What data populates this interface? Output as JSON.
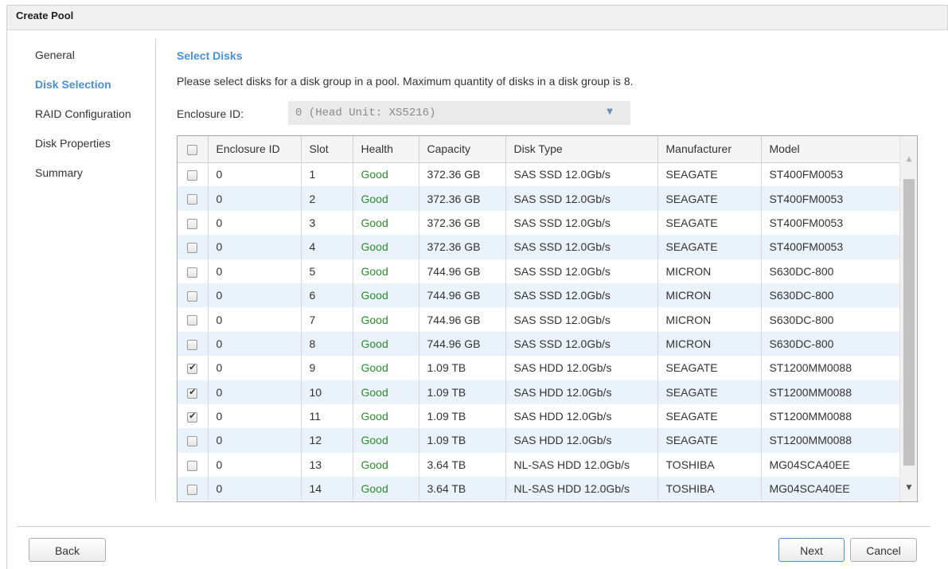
{
  "window": {
    "title": "Create Pool"
  },
  "nav": {
    "items": [
      {
        "label": "General",
        "active": false
      },
      {
        "label": "Disk Selection",
        "active": true
      },
      {
        "label": "RAID Configuration",
        "active": false
      },
      {
        "label": "Disk Properties",
        "active": false
      },
      {
        "label": "Summary",
        "active": false
      }
    ]
  },
  "main": {
    "section_title": "Select Disks",
    "instructions": "Please select disks for a disk group in a pool. Maximum quantity of disks in a disk group is 8.",
    "enclosure": {
      "label": "Enclosure ID:",
      "selected": "0 (Head Unit: XS5216)"
    }
  },
  "table": {
    "columns": [
      "Enclosure ID",
      "Slot",
      "Health",
      "Capacity",
      "Disk Type",
      "Manufacturer",
      "Model"
    ],
    "rows": [
      {
        "checked": false,
        "enclosure": "0",
        "slot": "1",
        "health": "Good",
        "capacity": "372.36 GB",
        "type": "SAS SSD 12.0Gb/s",
        "manufacturer": "SEAGATE",
        "model": "ST400FM0053"
      },
      {
        "checked": false,
        "enclosure": "0",
        "slot": "2",
        "health": "Good",
        "capacity": "372.36 GB",
        "type": "SAS SSD 12.0Gb/s",
        "manufacturer": "SEAGATE",
        "model": "ST400FM0053"
      },
      {
        "checked": false,
        "enclosure": "0",
        "slot": "3",
        "health": "Good",
        "capacity": "372.36 GB",
        "type": "SAS SSD 12.0Gb/s",
        "manufacturer": "SEAGATE",
        "model": "ST400FM0053"
      },
      {
        "checked": false,
        "enclosure": "0",
        "slot": "4",
        "health": "Good",
        "capacity": "372.36 GB",
        "type": "SAS SSD 12.0Gb/s",
        "manufacturer": "SEAGATE",
        "model": "ST400FM0053"
      },
      {
        "checked": false,
        "enclosure": "0",
        "slot": "5",
        "health": "Good",
        "capacity": "744.96 GB",
        "type": "SAS SSD 12.0Gb/s",
        "manufacturer": "MICRON",
        "model": "S630DC-800"
      },
      {
        "checked": false,
        "enclosure": "0",
        "slot": "6",
        "health": "Good",
        "capacity": "744.96 GB",
        "type": "SAS SSD 12.0Gb/s",
        "manufacturer": "MICRON",
        "model": "S630DC-800"
      },
      {
        "checked": false,
        "enclosure": "0",
        "slot": "7",
        "health": "Good",
        "capacity": "744.96 GB",
        "type": "SAS SSD 12.0Gb/s",
        "manufacturer": "MICRON",
        "model": "S630DC-800"
      },
      {
        "checked": false,
        "enclosure": "0",
        "slot": "8",
        "health": "Good",
        "capacity": "744.96 GB",
        "type": "SAS SSD 12.0Gb/s",
        "manufacturer": "MICRON",
        "model": "S630DC-800"
      },
      {
        "checked": true,
        "enclosure": "0",
        "slot": "9",
        "health": "Good",
        "capacity": "1.09 TB",
        "type": "SAS HDD 12.0Gb/s",
        "manufacturer": "SEAGATE",
        "model": "ST1200MM0088"
      },
      {
        "checked": true,
        "enclosure": "0",
        "slot": "10",
        "health": "Good",
        "capacity": "1.09 TB",
        "type": "SAS HDD 12.0Gb/s",
        "manufacturer": "SEAGATE",
        "model": "ST1200MM0088"
      },
      {
        "checked": true,
        "enclosure": "0",
        "slot": "11",
        "health": "Good",
        "capacity": "1.09 TB",
        "type": "SAS HDD 12.0Gb/s",
        "manufacturer": "SEAGATE",
        "model": "ST1200MM0088"
      },
      {
        "checked": false,
        "enclosure": "0",
        "slot": "12",
        "health": "Good",
        "capacity": "1.09 TB",
        "type": "SAS HDD 12.0Gb/s",
        "manufacturer": "SEAGATE",
        "model": "ST1200MM0088"
      },
      {
        "checked": false,
        "enclosure": "0",
        "slot": "13",
        "health": "Good",
        "capacity": "3.64 TB",
        "type": "NL-SAS HDD 12.0Gb/s",
        "manufacturer": "TOSHIBA",
        "model": "MG04SCA40EE"
      },
      {
        "checked": false,
        "enclosure": "0",
        "slot": "14",
        "health": "Good",
        "capacity": "3.64 TB",
        "type": "NL-SAS HDD 12.0Gb/s",
        "manufacturer": "TOSHIBA",
        "model": "MG04SCA40EE"
      }
    ]
  },
  "footer": {
    "back_label": "Back",
    "next_label": "Next",
    "cancel_label": "Cancel"
  },
  "colors": {
    "accent": "#4a90d9",
    "good": "#2e8b2e",
    "row_alt": "#eaf2fb"
  },
  "icons": {
    "select_arrow": "dropdown-arrow-icon",
    "scroll_up": "scroll-up-icon",
    "scroll_down": "scroll-down-icon"
  }
}
